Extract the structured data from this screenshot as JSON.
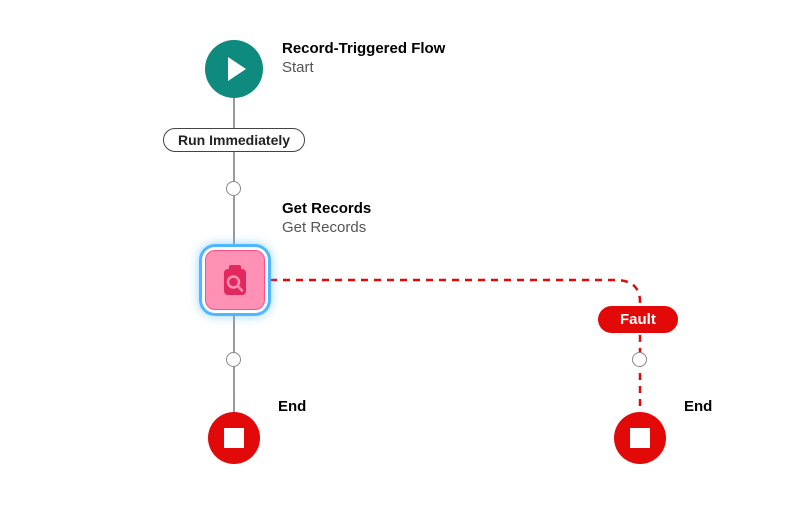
{
  "start": {
    "title": "Record-Triggered Flow",
    "subtitle": "Start"
  },
  "run_pill": "Run Immediately",
  "get_records": {
    "title": "Get Records",
    "subtitle": "Get Records"
  },
  "fault_label": "Fault",
  "end_label_left": "End",
  "end_label_right": "End",
  "colors": {
    "start": "#0f8a7e",
    "data": "#ff91b5",
    "data_border": "#ff4f89",
    "glow": "#4fb7ff",
    "error": "#e20909",
    "line": "#9a9a9a",
    "fault_line": "#e20909"
  }
}
